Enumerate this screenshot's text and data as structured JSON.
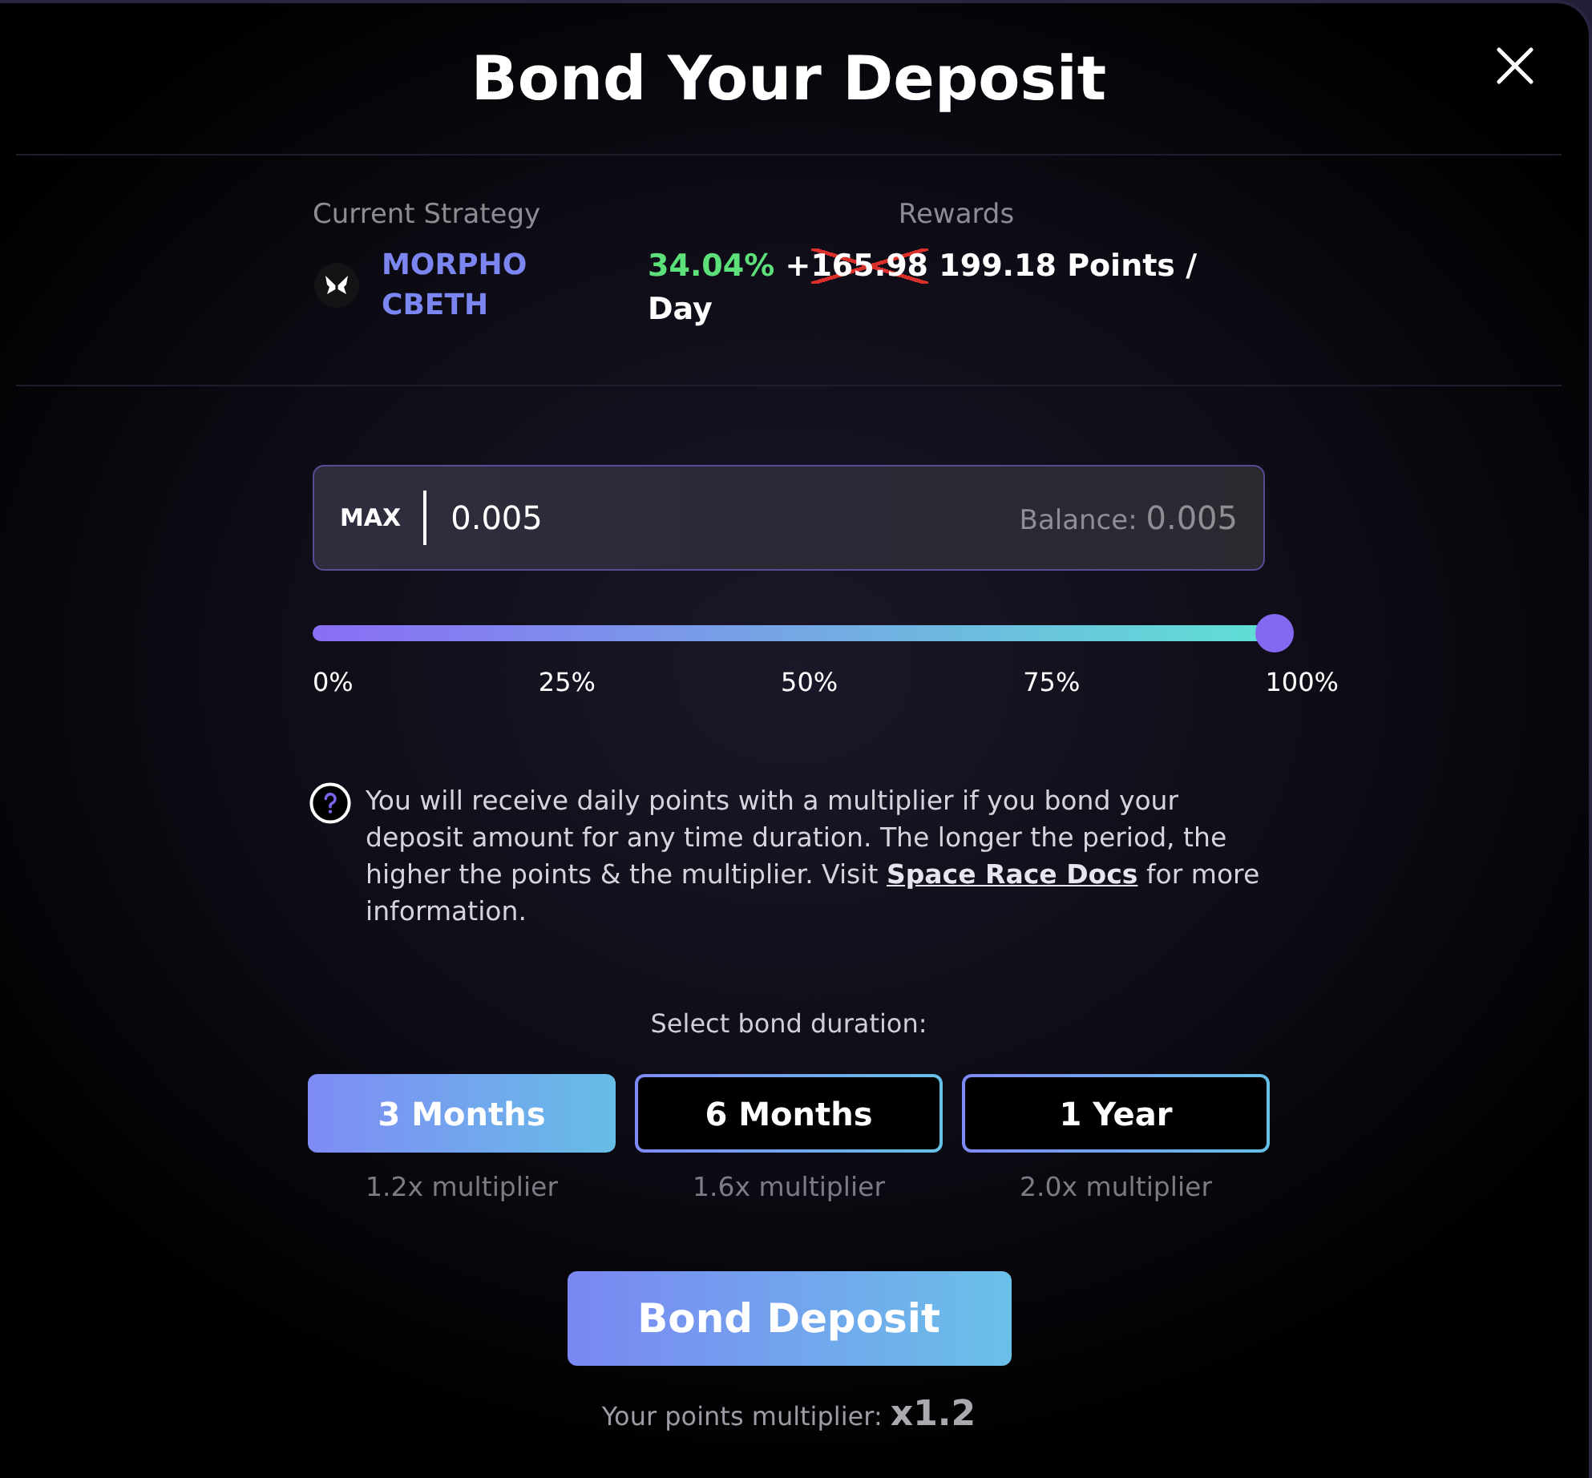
{
  "dialog": {
    "title": "Bond Your Deposit"
  },
  "strategy": {
    "label": "Current Strategy",
    "name": "MORPHO CBETH"
  },
  "rewards": {
    "label": "Rewards",
    "rate": "34.04%",
    "bonus_prefix": "+",
    "old_points": "165.98",
    "crossed_out": true,
    "points": "199.18 Points / Day"
  },
  "amount": {
    "max_label": "MAX",
    "value": "0.005",
    "balance_label": "Balance:",
    "balance": "0.005"
  },
  "slider": {
    "level": 1,
    "ticks": [
      "0%",
      "25%",
      "50%",
      "75%",
      "100%"
    ]
  },
  "info": {
    "text": "You will receive daily points with a multiplier if you bond your deposit amount for any time duration. The longer the period, the higher the points & the multiplier. Visit ",
    "link": "Space Race Docs",
    "text_end": " for more information."
  },
  "duration": {
    "label": "Select bond duration:",
    "options": [
      {
        "label": "3 Months",
        "multiplier": "1.2x multiplier",
        "selected": true
      },
      {
        "label": "6 Months",
        "multiplier": "1.6x multiplier",
        "selected": false
      },
      {
        "label": "1 Year",
        "multiplier": "2.0x multiplier",
        "selected": false
      }
    ]
  },
  "submit": {
    "label": "Bond Deposit"
  },
  "points_multiplier": {
    "label": "Your points multiplier:",
    "value": "x1.2"
  }
}
